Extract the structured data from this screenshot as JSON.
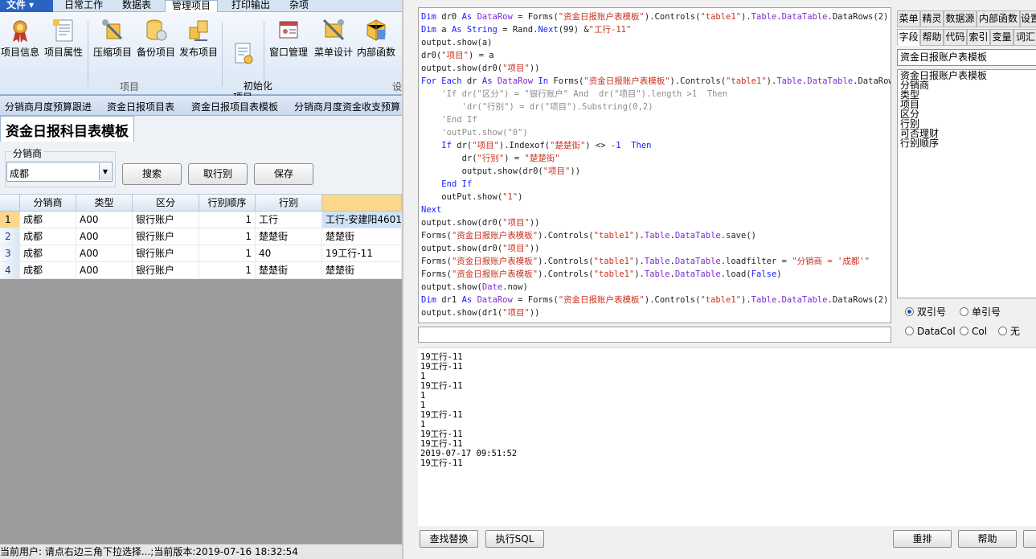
{
  "ribbon": {
    "file_tab": "文件 ▾",
    "tabs": [
      "日常工作",
      "数据表",
      "管理项目",
      "打印输出",
      "杂项"
    ],
    "active_tab": "管理项目",
    "buttons": [
      {
        "label": "项目信息",
        "icon": "medal-icon"
      },
      {
        "label": "项目属性",
        "icon": "document-icon"
      },
      {
        "label": "压缩项目",
        "icon": "compress-tools-icon"
      },
      {
        "label": "备份项目",
        "icon": "database-backup-icon"
      },
      {
        "label": "发布项目",
        "icon": "publish-icon"
      },
      {
        "label": "初始化\n项目",
        "icon": "init-icon"
      },
      {
        "label": "窗口管理",
        "icon": "window-icon"
      },
      {
        "label": "菜单设计",
        "icon": "menu-design-icon"
      },
      {
        "label": "内部函数",
        "icon": "function-icon"
      }
    ],
    "group_label_project": "项目",
    "group_label_design": "设"
  },
  "doc_tabs": [
    "分销商月度预算跟进",
    "资金日报项目表",
    "资金日报项目表模板",
    "分销商月度资金收支预算"
  ],
  "form": {
    "title": "资金日报科目表模板",
    "filter_label": "分销商",
    "filter_value": "成都",
    "buttons": {
      "search": "搜索",
      "get_bank": "取行别",
      "save": "保存"
    }
  },
  "grid": {
    "headers": [
      "分销商",
      "类型",
      "区分",
      "行别顺序",
      "行别",
      ""
    ],
    "rows": [
      {
        "n": "1",
        "cells": [
          "成都",
          "A00",
          "银行账户",
          "1",
          "工行",
          "工行-安建阳4601"
        ]
      },
      {
        "n": "2",
        "cells": [
          "成都",
          "A00",
          "银行账户",
          "1",
          "楚楚街",
          "楚楚街"
        ]
      },
      {
        "n": "3",
        "cells": [
          "成都",
          "A00",
          "银行账户",
          "1",
          "40",
          "19工行-11"
        ]
      },
      {
        "n": "4",
        "cells": [
          "成都",
          "A00",
          "银行账户",
          "1",
          "楚楚街",
          "楚楚街"
        ]
      }
    ]
  },
  "status": "当前用户: 请点右边三角下拉选择...;当前版本:2019-07-16 18:32:54",
  "code_lines": [
    [
      [
        "Dim",
        "kw"
      ],
      [
        " dr0 ",
        ""
      ],
      [
        "As",
        "kw"
      ],
      [
        " ",
        ""
      ],
      [
        "DataRow",
        "ob"
      ],
      [
        " = Forms(",
        ""
      ],
      [
        "\"资金日报账户表模板\"",
        "st"
      ],
      [
        ").Controls(",
        ""
      ],
      [
        "\"table1\"",
        "st"
      ],
      [
        ").",
        ""
      ],
      [
        "Table",
        "ob"
      ],
      [
        ".",
        ""
      ],
      [
        "DataTable",
        "ob"
      ],
      [
        ".DataRows(2)",
        ""
      ]
    ],
    [
      [
        "Dim",
        "kw"
      ],
      [
        " a ",
        ""
      ],
      [
        "As",
        "kw"
      ],
      [
        " ",
        ""
      ],
      [
        "String",
        "kw"
      ],
      [
        " = Rand.",
        ""
      ],
      [
        "Next",
        "kw"
      ],
      [
        "(99) &",
        ""
      ],
      [
        "\"工行-11\"",
        "st"
      ]
    ],
    [
      [
        "output.show(a)",
        ""
      ]
    ],
    [
      [
        "dr0(",
        ""
      ],
      [
        "\"项目\"",
        "st"
      ],
      [
        ") = a",
        ""
      ]
    ],
    [
      [
        "output.show(dr0(",
        ""
      ],
      [
        "\"项目\"",
        "st"
      ],
      [
        "))",
        ""
      ]
    ],
    [
      [
        "For Each",
        "kw"
      ],
      [
        " dr ",
        ""
      ],
      [
        "As",
        "kw"
      ],
      [
        " ",
        ""
      ],
      [
        "DataRow",
        "ob"
      ],
      [
        " ",
        ""
      ],
      [
        "In",
        "kw"
      ],
      [
        " Forms(",
        ""
      ],
      [
        "\"资金日报账户表模板\"",
        "st"
      ],
      [
        ").Controls(",
        ""
      ],
      [
        "\"table1\"",
        "st"
      ],
      [
        ").",
        ""
      ],
      [
        "Table",
        "ob"
      ],
      [
        ".",
        ""
      ],
      [
        "DataTable",
        "ob"
      ],
      [
        ".DataRows",
        ""
      ]
    ],
    [
      [
        "    'If dr(\"区分\") = \"银行账户\" And  dr(\"项目\").length >1  Then",
        "cm"
      ]
    ],
    [
      [
        "        'dr(\"行别\") = dr(\"项目\").Substring(0,2)",
        "cm"
      ]
    ],
    [
      [
        "    'End If",
        "cm"
      ]
    ],
    [
      [
        "    'outPut.show(\"0\")",
        "cm"
      ]
    ],
    [
      [
        "    ",
        ""
      ],
      [
        "If",
        "kw"
      ],
      [
        " dr(",
        ""
      ],
      [
        "\"项目\"",
        "st"
      ],
      [
        ").Indexof(",
        ""
      ],
      [
        "\"楚楚街\"",
        "st"
      ],
      [
        ") <> ",
        ""
      ],
      [
        "-1",
        "kw"
      ],
      [
        "  ",
        ""
      ],
      [
        "Then",
        "kw"
      ]
    ],
    [
      [
        "        dr(",
        ""
      ],
      [
        "\"行别\"",
        "st"
      ],
      [
        ") = ",
        ""
      ],
      [
        "\"楚楚街\"",
        "st"
      ]
    ],
    [
      [
        "        output.show(dr0(",
        ""
      ],
      [
        "\"项目\"",
        "st"
      ],
      [
        "))",
        ""
      ]
    ],
    [
      [
        "    ",
        ""
      ],
      [
        "End If",
        "kw"
      ]
    ],
    [
      [
        "    outPut.show(",
        ""
      ],
      [
        "\"1\"",
        "st"
      ],
      [
        ")",
        ""
      ]
    ],
    [
      [
        "Next",
        "kw"
      ]
    ],
    [
      [
        "output.show(dr0(",
        ""
      ],
      [
        "\"项目\"",
        "st"
      ],
      [
        "))",
        ""
      ]
    ],
    [
      [
        "Forms(",
        ""
      ],
      [
        "\"资金日报账户表模板\"",
        "st"
      ],
      [
        ").Controls(",
        ""
      ],
      [
        "\"table1\"",
        "st"
      ],
      [
        ").",
        ""
      ],
      [
        "Table",
        "ob"
      ],
      [
        ".",
        ""
      ],
      [
        "DataTable",
        "ob"
      ],
      [
        ".save()",
        ""
      ]
    ],
    [
      [
        "output.show(dr0(",
        ""
      ],
      [
        "\"项目\"",
        "st"
      ],
      [
        "))",
        ""
      ]
    ],
    [
      [
        "Forms(",
        ""
      ],
      [
        "\"资金日报账户表模板\"",
        "st"
      ],
      [
        ").Controls(",
        ""
      ],
      [
        "\"table1\"",
        "st"
      ],
      [
        ").",
        ""
      ],
      [
        "Table",
        "ob"
      ],
      [
        ".",
        ""
      ],
      [
        "DataTable",
        "ob"
      ],
      [
        ".loadfilter = ",
        ""
      ],
      [
        "\"分销商 = '成都'\"",
        "st"
      ]
    ],
    [
      [
        "Forms(",
        ""
      ],
      [
        "\"资金日报账户表模板\"",
        "st"
      ],
      [
        ").Controls(",
        ""
      ],
      [
        "\"table1\"",
        "st"
      ],
      [
        ").",
        ""
      ],
      [
        "Table",
        "ob"
      ],
      [
        ".",
        ""
      ],
      [
        "DataTable",
        "ob"
      ],
      [
        ".load(",
        ""
      ],
      [
        "False",
        "kw"
      ],
      [
        ")",
        ""
      ]
    ],
    [
      [
        "output.show(",
        ""
      ],
      [
        "Date",
        "ob"
      ],
      [
        ".now)",
        ""
      ]
    ],
    [
      [
        "Dim",
        "kw"
      ],
      [
        " dr1 ",
        ""
      ],
      [
        "As",
        "kw"
      ],
      [
        " ",
        ""
      ],
      [
        "DataRow",
        "ob"
      ],
      [
        " = Forms(",
        ""
      ],
      [
        "\"资金日报账户表模板\"",
        "st"
      ],
      [
        ").Controls(",
        ""
      ],
      [
        "\"table1\"",
        "st"
      ],
      [
        ").",
        ""
      ],
      [
        "Table",
        "ob"
      ],
      [
        ".",
        ""
      ],
      [
        "DataTable",
        "ob"
      ],
      [
        ".DataRows(2)",
        ""
      ]
    ],
    [
      [
        "output.show(dr1(",
        ""
      ],
      [
        "\"项目\"",
        "st"
      ],
      [
        "))",
        ""
      ]
    ]
  ],
  "output_lines": [
    "19工行-11",
    "19工行-11",
    "1",
    "19工行-11",
    "1",
    "1",
    "19工行-11",
    "1",
    "19工行-11",
    "19工行-11",
    "2019-07-17 09:51:52",
    "19工行-11"
  ],
  "side_tabs_row1": [
    "菜单",
    "精灵",
    "数据源",
    "内部函数",
    "设置"
  ],
  "side_tabs_row2": [
    "字段",
    "帮助",
    "代码",
    "索引",
    "变量",
    "词汇"
  ],
  "active_side_tab": "字段",
  "table_select": "资金日报账户表模板",
  "field_list": [
    "资金日报账户表模板",
    "分销商",
    "类型",
    "项目",
    "区分",
    "行别",
    "可否理财",
    "行别顺序"
  ],
  "quote_options": {
    "double": "双引号",
    "single": "单引号",
    "datacol": "DataCol",
    "col": "Col",
    "none": "无",
    "selected": "double"
  },
  "bottom_buttons": {
    "find_replace": "查找替换",
    "exec_sql": "执行SQL",
    "reformat": "重排",
    "help": "帮助"
  }
}
